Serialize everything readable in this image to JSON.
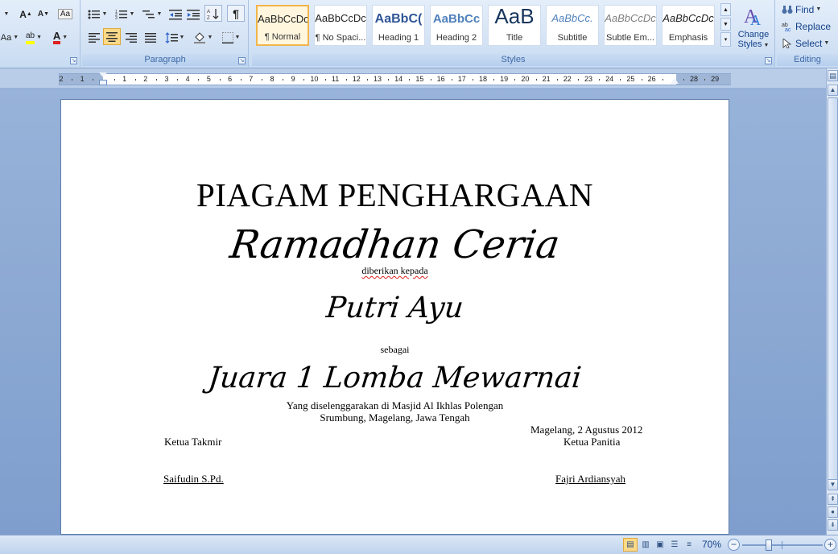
{
  "ribbon": {
    "font_group": {
      "grow_font": "A",
      "shrink_font": "A",
      "change_case": "Aa",
      "highlight_label": "ab",
      "font_color_label": "A"
    },
    "paragraph_group": {
      "label": "Paragraph",
      "show_marks": "¶"
    },
    "styles_group": {
      "label": "Styles",
      "items": [
        {
          "sample": "AaBbCcDc",
          "name": "¶ Normal"
        },
        {
          "sample": "AaBbCcDc",
          "name": "¶ No Spaci..."
        },
        {
          "sample": "AaBbC(",
          "name": "Heading 1"
        },
        {
          "sample": "AaBbCc",
          "name": "Heading 2"
        },
        {
          "sample": "AaB",
          "name": "Title"
        },
        {
          "sample": "AaBbCc.",
          "name": "Subtitle"
        },
        {
          "sample": "AaBbCcDc",
          "name": "Subtle Em..."
        },
        {
          "sample": "AaBbCcDc",
          "name": "Emphasis"
        }
      ],
      "change_styles_line1": "Change",
      "change_styles_line2": "Styles"
    },
    "editing_group": {
      "label": "Editing",
      "find": "Find",
      "replace": "Replace",
      "select": "Select"
    }
  },
  "ruler": {
    "numbers": [
      "2",
      "1",
      "",
      "1",
      "2",
      "3",
      "4",
      "5",
      "6",
      "7",
      "8",
      "9",
      "10",
      "11",
      "12",
      "13",
      "14",
      "15",
      "16",
      "17",
      "18",
      "19",
      "20",
      "21",
      "22",
      "23",
      "24",
      "25",
      "26",
      "",
      "28",
      "29"
    ]
  },
  "document": {
    "title": "PIAGAM PENGHARGAAN",
    "event": "Ramadhan Ceria",
    "given_to": "diberikan kepada",
    "recipient": "Putri Ayu",
    "as": "sebagai",
    "award": "Juara 1 Lomba Mewarnai",
    "organizer_line1": "Yang diselenggarakan di Masjid Al Ikhlas Polengan",
    "organizer_line2": "Srumbung, Magelang, Jawa Tengah",
    "place_date": "Magelang, 2 Agustus 2012",
    "left_role": "Ketua Takmir",
    "right_role": "Ketua Panitia",
    "left_name": "Saifudin S.Pd.",
    "right_name": "Fajri Ardiansyah"
  },
  "statusbar": {
    "zoom": "70%"
  },
  "colors": {
    "ribbon_bg": "#d6e4f5",
    "workspace_bg": "#8aa7d1",
    "selected_style": "#f1b54b"
  }
}
